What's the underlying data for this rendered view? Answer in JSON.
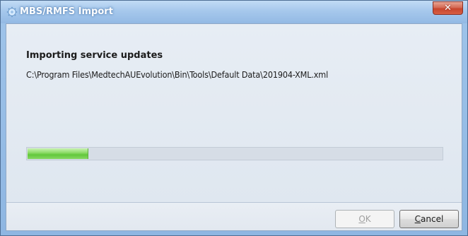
{
  "window": {
    "title": "MBS/RMFS Import",
    "close_glyph": "✕"
  },
  "content": {
    "heading": "Importing service updates",
    "file_path": "C:\\Program Files\\MedtechAUEvolution\\Bin\\Tools\\Default Data\\201904-XML.xml"
  },
  "progress": {
    "fraction": 0.145
  },
  "buttons": {
    "ok": {
      "mnemonic": "O",
      "rest": "K",
      "enabled": false
    },
    "cancel": {
      "mnemonic": "C",
      "rest": "ancel",
      "enabled": true
    }
  },
  "icons": {
    "app": "gear-icon",
    "close": "close-icon"
  },
  "colors": {
    "progress_green": "#6fd146",
    "title_blue": "#9fc4ea",
    "close_red": "#c7452d"
  }
}
